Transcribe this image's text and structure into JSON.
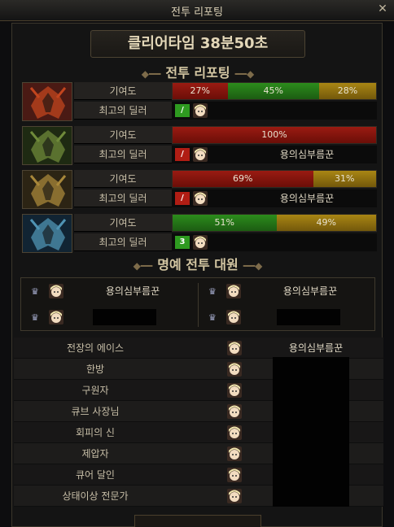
{
  "window": {
    "title": "전투 리포팅"
  },
  "clear_time": "클리어타임 38분50초",
  "sections": {
    "battle_report": "전투 리포팅",
    "honor": "명예 전투 대원"
  },
  "labels": {
    "contribution": "기여도",
    "best_dealer": "최고의 딜러"
  },
  "bosses": [
    {
      "icon": "red-boss-icon",
      "segments": [
        {
          "color": "red",
          "value": "27%",
          "fraction": 0.27
        },
        {
          "color": "green",
          "value": "45%",
          "fraction": 0.45
        },
        {
          "color": "gold",
          "value": "28%",
          "fraction": 0.28
        }
      ],
      "dealer_badge": "/",
      "dealer_badge_color": "green",
      "dealer_name": ""
    },
    {
      "icon": "green-boss-icon",
      "segments": [
        {
          "color": "red",
          "value": "100%",
          "fraction": 1.0
        }
      ],
      "dealer_badge": "/",
      "dealer_badge_color": "red",
      "dealer_name": "용의심부름꾼"
    },
    {
      "icon": "gold-boss-icon",
      "segments": [
        {
          "color": "red",
          "value": "69%",
          "fraction": 0.69
        },
        {
          "color": "gold",
          "value": "31%",
          "fraction": 0.31
        }
      ],
      "dealer_badge": "/",
      "dealer_badge_color": "red",
      "dealer_name": "용의심부름꾼"
    },
    {
      "icon": "blue-boss-icon",
      "segments": [
        {
          "color": "green",
          "value": "51%",
          "fraction": 0.51
        },
        {
          "color": "gold",
          "value": "49%",
          "fraction": 0.49
        }
      ],
      "dealer_badge": "3",
      "dealer_badge_color": "green",
      "dealer_name": ""
    }
  ],
  "honor_members": [
    {
      "name": "용의심부름꾼"
    },
    {
      "name": "용의심부름꾼"
    },
    {
      "name": ""
    },
    {
      "name": ""
    }
  ],
  "awards": [
    {
      "label": "전장의 에이스",
      "name": "용의심부름꾼"
    },
    {
      "label": "한방",
      "name": ""
    },
    {
      "label": "구원자",
      "name": ""
    },
    {
      "label": "큐브 사장님",
      "name": ""
    },
    {
      "label": "회피의 신",
      "name": ""
    },
    {
      "label": "제압자",
      "name": ""
    },
    {
      "label": "큐어 달인",
      "name": ""
    },
    {
      "label": "상태이상 전문가",
      "name": ""
    }
  ],
  "colors": {
    "red": "#9a1b12",
    "green": "#2c8c1c",
    "gold": "#a98614",
    "frame": "#3b362b"
  }
}
